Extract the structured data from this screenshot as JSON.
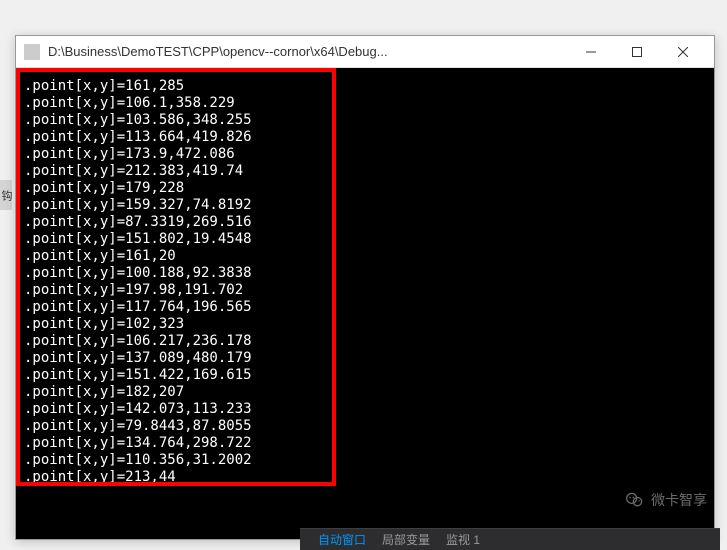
{
  "window": {
    "title": "D:\\Business\\DemoTEST\\CPP\\opencv--cornor\\x64\\Debug..."
  },
  "console": {
    "lines": [
      ".point[x,y]=161,285",
      ".point[x,y]=106.1,358.229",
      ".point[x,y]=103.586,348.255",
      ".point[x,y]=113.664,419.826",
      ".point[x,y]=173.9,472.086",
      ".point[x,y]=212.383,419.74",
      ".point[x,y]=179,228",
      ".point[x,y]=159.327,74.8192",
      ".point[x,y]=87.3319,269.516",
      ".point[x,y]=151.802,19.4548",
      ".point[x,y]=161,20",
      ".point[x,y]=100.188,92.3838",
      ".point[x,y]=197.98,191.702",
      ".point[x,y]=117.764,196.565",
      ".point[x,y]=102,323",
      ".point[x,y]=106.217,236.178",
      ".point[x,y]=137.089,480.179",
      ".point[x,y]=151.422,169.615",
      ".point[x,y]=182,207",
      ".point[x,y]=142.073,113.233",
      ".point[x,y]=79.8443,87.8055",
      ".point[x,y]=134.764,298.722",
      ".point[x,y]=110.356,31.2002",
      ".point[x,y]=213,44"
    ]
  },
  "bottom": {
    "tab1": "自动窗口",
    "tab2": "局部变量",
    "tab3": "监视 1"
  },
  "badge": {
    "text": "微卡智享"
  },
  "leftEdge": "钩"
}
